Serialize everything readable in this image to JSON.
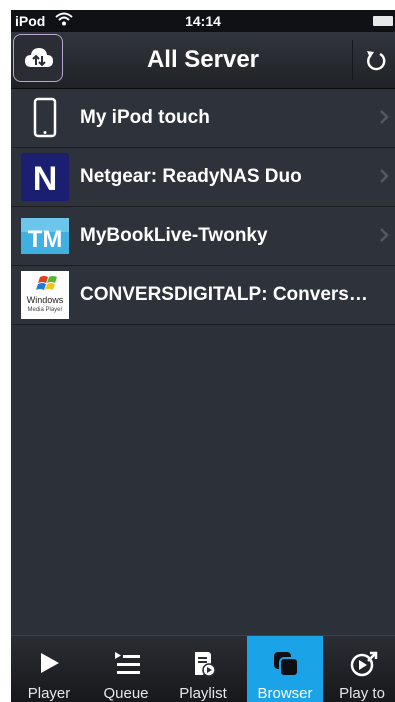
{
  "status_bar": {
    "carrier": "iPod",
    "time": "14:14"
  },
  "nav": {
    "title": "All Server"
  },
  "servers": [
    {
      "label": "My iPod touch",
      "icon": "ipod-device-icon"
    },
    {
      "label": "Netgear: ReadyNAS Duo",
      "icon": "netgear-logo-icon",
      "logo_text": "N"
    },
    {
      "label": "MyBookLive-Twonky",
      "icon": "twonky-logo-icon",
      "logo_text": "TM"
    },
    {
      "label": "CONVERSDIGITALP: Conversdi…",
      "icon": "windows-media-player-icon",
      "logo_text": "Windows Media Player"
    }
  ],
  "tabs": [
    {
      "label": "Player",
      "icon": "play-icon"
    },
    {
      "label": "Queue",
      "icon": "queue-icon"
    },
    {
      "label": "Playlist",
      "icon": "playlist-icon"
    },
    {
      "label": "Browser",
      "icon": "browser-icon",
      "active": true
    },
    {
      "label": "Play to",
      "icon": "play-to-icon"
    }
  ],
  "colors": {
    "accent": "#1aa3e6",
    "background": "#2c3038",
    "netgear": "#1b1f72",
    "twonky": "#3fb0e0"
  }
}
